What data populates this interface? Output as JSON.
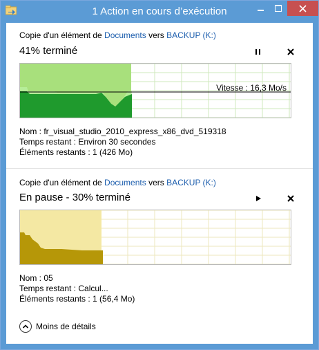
{
  "window": {
    "title": "1 Action en cours d’exécution",
    "accent": "#5b9bd5",
    "close_color": "#c75050"
  },
  "operations": [
    {
      "header": {
        "prefix": "Copie d'un élément de ",
        "source": "Documents",
        "middle": " vers ",
        "destination": "BACKUP (K:)"
      },
      "status": "41% terminé",
      "progress": 0.41,
      "state": "running",
      "control_icons": [
        "pause-icon",
        "close-icon"
      ],
      "speed_label": "Vitesse : 16,3 Mo/s",
      "speed_level": 0.48,
      "colors": {
        "fill": "#a8e07c",
        "history": "#1f9a2d",
        "grid": "#cfe8bd"
      },
      "details": [
        {
          "label": "Nom : ",
          "value": "fr_visual_studio_2010_express_x86_dvd_519318"
        },
        {
          "label": "Temps restant : ",
          "value": "Environ 30 secondes"
        },
        {
          "label": "Éléments restants : ",
          "value": "1 (426 Mo)"
        }
      ]
    },
    {
      "header": {
        "prefix": "Copie d'un élément de ",
        "source": "Documents",
        "middle": " vers ",
        "destination": "BACKUP (K:)"
      },
      "status": "En pause - 30% terminé",
      "progress": 0.3,
      "state": "paused",
      "control_icons": [
        "play-icon",
        "close-icon"
      ],
      "colors": {
        "fill": "#f4e8a3",
        "history": "#b69708",
        "grid": "#ece7bd"
      },
      "details": [
        {
          "label": "Nom : ",
          "value": "05"
        },
        {
          "label": "Temps restant : ",
          "value": "Calcul..."
        },
        {
          "label": "Éléments restants : ",
          "value": "1 (56,4 Mo)"
        }
      ]
    }
  ],
  "footer": {
    "label": "Moins de détails",
    "icon": "chevron-up-icon"
  }
}
